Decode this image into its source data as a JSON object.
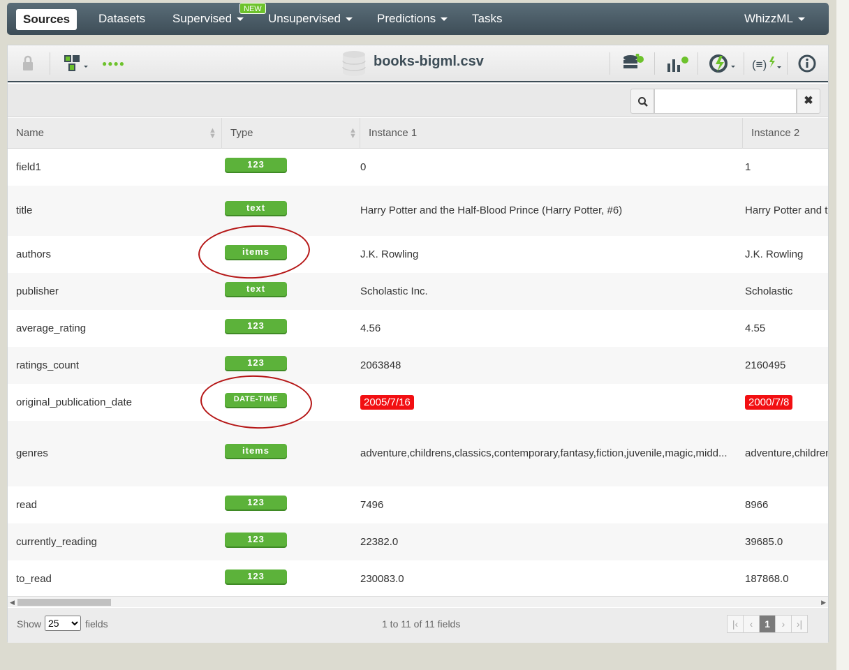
{
  "nav": {
    "sources": "Sources",
    "datasets": "Datasets",
    "supervised": "Supervised",
    "new_badge": "NEW",
    "unsupervised": "Unsupervised",
    "predictions": "Predictions",
    "tasks": "Tasks",
    "whizzml": "WhizzML"
  },
  "toolbar": {
    "title": "books-bigml.csv",
    "status_dots": "●●●●"
  },
  "search": {
    "placeholder": "",
    "value": ""
  },
  "table": {
    "columns": [
      "Name",
      "Type",
      "Instance 1",
      "Instance 2"
    ],
    "rows": [
      {
        "name": "field1",
        "type": "123",
        "i1": "0",
        "i2": "1"
      },
      {
        "name": "title",
        "type": "text",
        "i1": "Harry Potter and the Half-Blood Prince (Harry Potter, #6)",
        "i2": "Harry Potter and th"
      },
      {
        "name": "authors",
        "type": "items",
        "i1": "J.K. Rowling",
        "i2": "J.K. Rowling"
      },
      {
        "name": "publisher",
        "type": "text",
        "i1": "Scholastic Inc.",
        "i2": "Scholastic"
      },
      {
        "name": "average_rating",
        "type": "123",
        "i1": "4.56",
        "i2": "4.55"
      },
      {
        "name": "ratings_count",
        "type": "123",
        "i1": "2063848",
        "i2": "2160495"
      },
      {
        "name": "original_publication_date",
        "type": "DATE-TIME",
        "i1": "2005/7/16",
        "i2": "2000/7/8"
      },
      {
        "name": "genres",
        "type": "items",
        "i1": "adventure,childrens,classics,contemporary,fantasy,fiction,juvenile,magic,midd...",
        "i2": "adventure,children"
      },
      {
        "name": "read",
        "type": "123",
        "i1": "7496",
        "i2": "8966"
      },
      {
        "name": "currently_reading",
        "type": "123",
        "i1": "22382.0",
        "i2": "39685.0"
      },
      {
        "name": "to_read",
        "type": "123",
        "i1": "230083.0",
        "i2": "187868.0"
      }
    ]
  },
  "footer": {
    "show": "Show",
    "page_size": "25",
    "fields": "fields",
    "count": "1 to 11 of 11 fields",
    "current_page": "1"
  },
  "colors": {
    "nav": "#3d4d57",
    "badge_green": "#5cb23a",
    "date_red": "#f20f12",
    "annotation": "#b51616"
  }
}
